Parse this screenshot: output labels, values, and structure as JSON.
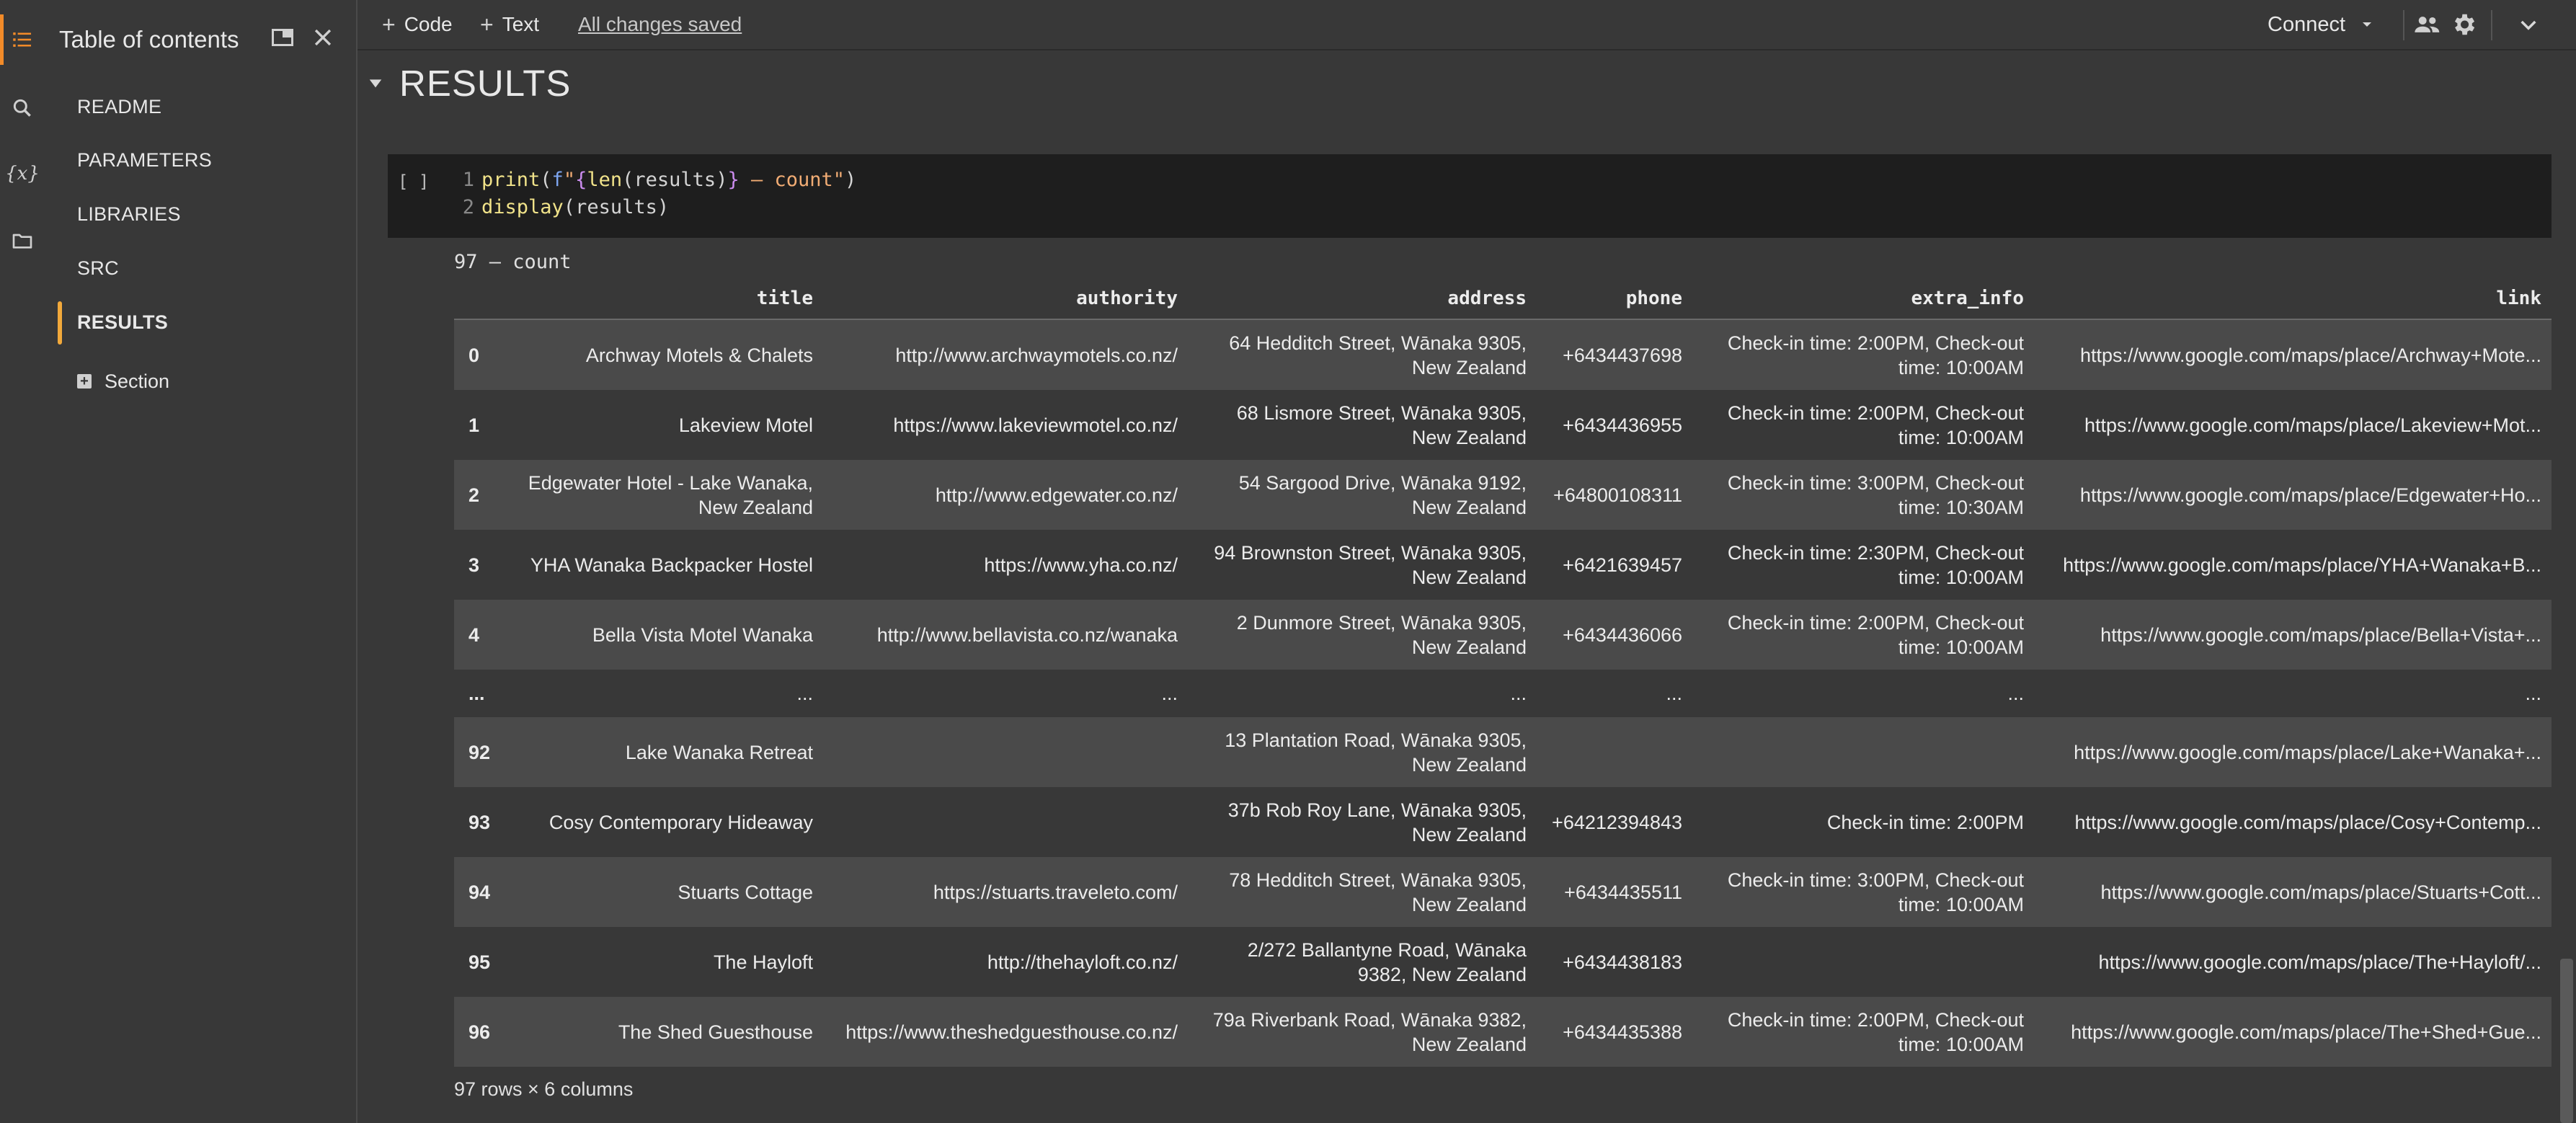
{
  "toc": {
    "title": "Table of contents",
    "items": [
      {
        "label": "README"
      },
      {
        "label": "PARAMETERS"
      },
      {
        "label": "LIBRARIES"
      },
      {
        "label": "SRC"
      },
      {
        "label": "RESULTS"
      }
    ],
    "section_label": "Section",
    "active_index": 4
  },
  "rail_icons": [
    "toc-icon",
    "search-icon",
    "variables-icon",
    "folder-icon"
  ],
  "rail_var_glyph": "{x}",
  "toolbar": {
    "code_label": "Code",
    "text_label": "Text",
    "saved_label": "All changes saved",
    "connect_label": "Connect"
  },
  "section_heading": "RESULTS",
  "cell": {
    "run_bracket": "[ ]",
    "line_numbers": [
      "1",
      "2"
    ],
    "line1": {
      "fn": "print",
      "p1": "(",
      "fpre": "f",
      "q1": "\"",
      "b1": "{",
      "inner_fn": "len",
      "p2": "(",
      "var": "results",
      "p3": ")",
      "b2": "}",
      "rest": " – count\"",
      "p4": ")"
    },
    "line2": {
      "fn": "display",
      "p1": "(",
      "var": "results",
      "p2": ")"
    }
  },
  "output_text": "97 – count",
  "table": {
    "columns": [
      "title",
      "authority",
      "address",
      "phone",
      "extra_info",
      "link"
    ],
    "rows": [
      {
        "idx": "0",
        "title": "Archway Motels & Chalets",
        "authority": "http://www.archwaymotels.co.nz/",
        "address": "64 Hedditch Street, Wānaka 9305, New Zealand",
        "phone": "+6434437698",
        "extra_info": "Check-in time: 2:00PM, Check-out time: 10:00AM",
        "link": "https://www.google.com/maps/place/Archway+Mote..."
      },
      {
        "idx": "1",
        "title": "Lakeview Motel",
        "authority": "https://www.lakeviewmotel.co.nz/",
        "address": "68 Lismore Street, Wānaka 9305, New Zealand",
        "phone": "+6434436955",
        "extra_info": "Check-in time: 2:00PM, Check-out time: 10:00AM",
        "link": "https://www.google.com/maps/place/Lakeview+Mot..."
      },
      {
        "idx": "2",
        "title": "Edgewater Hotel - Lake Wanaka, New Zealand",
        "authority": "http://www.edgewater.co.nz/",
        "address": "54 Sargood Drive, Wānaka 9192, New Zealand",
        "phone": "+64800108311",
        "extra_info": "Check-in time: 3:00PM, Check-out time: 10:30AM",
        "link": "https://www.google.com/maps/place/Edgewater+Ho..."
      },
      {
        "idx": "3",
        "title": "YHA Wanaka Backpacker Hostel",
        "authority": "https://www.yha.co.nz/",
        "address": "94 Brownston Street, Wānaka 9305, New Zealand",
        "phone": "+6421639457",
        "extra_info": "Check-in time: 2:30PM, Check-out time: 10:00AM",
        "link": "https://www.google.com/maps/place/YHA+Wanaka+B..."
      },
      {
        "idx": "4",
        "title": "Bella Vista Motel Wanaka",
        "authority": "http://www.bellavista.co.nz/wanaka",
        "address": "2 Dunmore Street, Wānaka 9305, New Zealand",
        "phone": "+6434436066",
        "extra_info": "Check-in time: 2:00PM, Check-out time: 10:00AM",
        "link": "https://www.google.com/maps/place/Bella+Vista+..."
      },
      {
        "idx": "...",
        "title": "...",
        "authority": "...",
        "address": "...",
        "phone": "...",
        "extra_info": "...",
        "link": "...",
        "ellipsis": true
      },
      {
        "idx": "92",
        "title": "Lake Wanaka Retreat",
        "authority": "",
        "address": "13 Plantation Road, Wānaka 9305, New Zealand",
        "phone": "",
        "extra_info": "",
        "link": "https://www.google.com/maps/place/Lake+Wanaka+..."
      },
      {
        "idx": "93",
        "title": "Cosy Contemporary Hideaway",
        "authority": "",
        "address": "37b Rob Roy Lane, Wānaka 9305, New Zealand",
        "phone": "+64212394843",
        "extra_info": "Check-in time: 2:00PM",
        "link": "https://www.google.com/maps/place/Cosy+Contemp..."
      },
      {
        "idx": "94",
        "title": "Stuarts Cottage",
        "authority": "https://stuarts.traveleto.com/",
        "address": "78 Hedditch Street, Wānaka 9305, New Zealand",
        "phone": "+6434435511",
        "extra_info": "Check-in time: 3:00PM, Check-out time: 10:00AM",
        "link": "https://www.google.com/maps/place/Stuarts+Cott..."
      },
      {
        "idx": "95",
        "title": "The Hayloft",
        "authority": "http://thehayloft.co.nz/",
        "address": "2/272 Ballantyne Road, Wānaka 9382, New Zealand",
        "phone": "+6434438183",
        "extra_info": "",
        "link": "https://www.google.com/maps/place/The+Hayloft/..."
      },
      {
        "idx": "96",
        "title": "The Shed Guesthouse",
        "authority": "https://www.theshedguesthouse.co.nz/",
        "address": "79a Riverbank Road, Wānaka 9382, New Zealand",
        "phone": "+6434435388",
        "extra_info": "Check-in time: 2:00PM, Check-out time: 10:00AM",
        "link": "https://www.google.com/maps/place/The+Shed+Gue..."
      }
    ]
  },
  "shape_text": "97 rows × 6 columns",
  "colors": {
    "accent": "#f28b29",
    "active_bar": "#f2a93b",
    "background": "#383838",
    "code_bg": "#1e1e1e",
    "row_alt": "#4a4a4a"
  }
}
